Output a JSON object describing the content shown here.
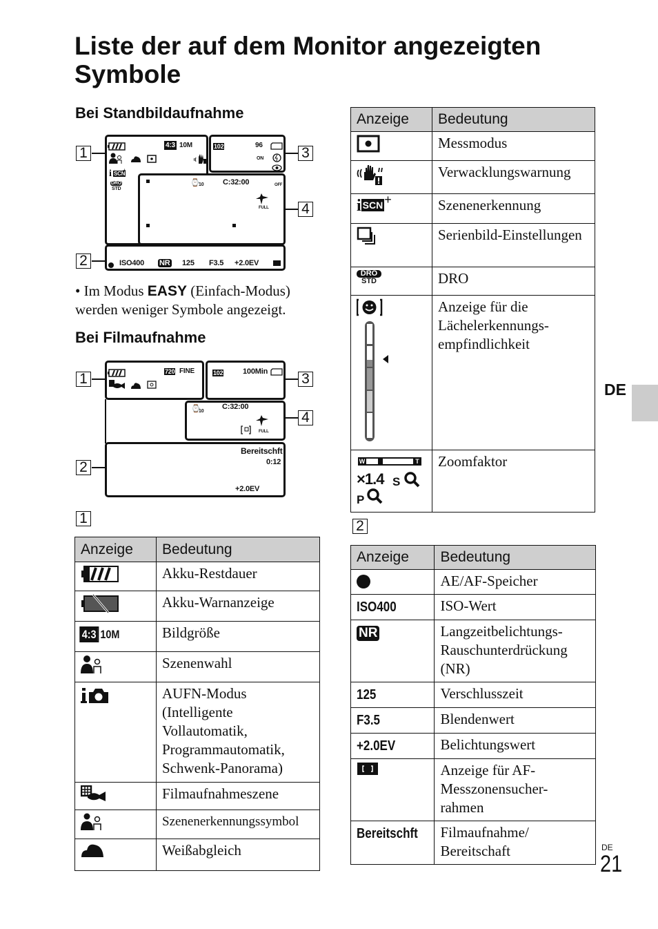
{
  "title": "Liste der auf dem Monitor angezeigten Symbole",
  "sections": {
    "still": "Bei Standbildaufnahme",
    "movie": "Bei Filmaufnahme"
  },
  "note": {
    "bullet": "•",
    "prefix": "Im Modus",
    "mode": "EASY",
    "suffix": "(Einfach-Modus) werden weniger Symbole angezeigt."
  },
  "callouts": [
    "1",
    "2",
    "3",
    "4"
  ],
  "still_display": {
    "image_size": "4:3",
    "megapixels": "10M",
    "folder": "102",
    "shots_left": "96",
    "face_detect": "ON",
    "timer": "10",
    "clock": "C:32:00",
    "smile": "OFF",
    "full": "FULL",
    "iso": "ISO400",
    "nr": "NR",
    "shutter": "125",
    "aperture": "F3.5",
    "ev": "+2.0EV",
    "dro": "DRO",
    "dro_std": "STD",
    "scn": "SCN"
  },
  "movie_display": {
    "quality": "720",
    "fine": "FINE",
    "folder": "102",
    "remaining": "100Min",
    "timer": "10",
    "clock": "C:32:00",
    "full": "FULL",
    "standby": "Bereitschft",
    "elapsed": "0:12",
    "ev": "+2.0EV"
  },
  "table1": {
    "label": "1",
    "headers": [
      "Anzeige",
      "Bedeutung"
    ],
    "rows": [
      {
        "icon": "battery-full-icon",
        "meaning": "Akku-Restdauer"
      },
      {
        "icon": "battery-warning-icon",
        "meaning": "Akku-Warnanzeige"
      },
      {
        "icon": "image-size-icon",
        "code_box": "4:3",
        "code": "10M",
        "meaning": "Bildgröße"
      },
      {
        "icon": "scene-select-icon",
        "meaning": "Szenenwahl"
      },
      {
        "icon": "intelligent-auto-icon",
        "meaning": "AUFN-Modus (Intelligente Vollautomatik, Programmautomatik, Schwenk-Panorama)"
      },
      {
        "icon": "movie-scene-icon",
        "meaning": "Filmaufnahmeszene"
      },
      {
        "icon": "scene-recognition-icon",
        "meaning": "Szenenerkennungssymbol"
      },
      {
        "icon": "white-balance-icon",
        "meaning": "Weißabgleich"
      }
    ]
  },
  "table1b": {
    "headers": [
      "Anzeige",
      "Bedeutung"
    ],
    "rows": [
      {
        "icon": "metering-mode-icon",
        "meaning": "Messmodus"
      },
      {
        "icon": "shake-warning-icon",
        "meaning": "Verwacklungswarnung"
      },
      {
        "icon": "iscn-plus-icon",
        "code": "SCN",
        "meaning": "Szenenerkennung"
      },
      {
        "icon": "burst-icon",
        "meaning": "Serienbild-Einstellungen"
      },
      {
        "icon": "dro-icon",
        "code": "DRO",
        "code2": "STD",
        "meaning": "DRO"
      },
      {
        "icon": "smile-sensitivity-icon",
        "meaning": "Anzeige für die Lächelerkennungs-empfindlichkeit"
      },
      {
        "icon": "zoom-factor-icon",
        "zoom_w": "W",
        "zoom_t": "T",
        "zoom_value": "×1.4",
        "zoom_s": "S",
        "zoom_p": "P",
        "meaning": "Zoomfaktor"
      }
    ]
  },
  "table2": {
    "label": "2",
    "headers": [
      "Anzeige",
      "Bedeutung"
    ],
    "rows": [
      {
        "icon": "ae-af-lock-icon",
        "meaning": "AE/AF-Speicher"
      },
      {
        "code": "ISO400",
        "meaning": "ISO-Wert"
      },
      {
        "icon": "nr-icon",
        "code": "NR",
        "meaning": "Langzeitbelichtungs-Rauschunterdrückung (NR)"
      },
      {
        "code": "125",
        "meaning": "Verschlusszeit"
      },
      {
        "code": "F3.5",
        "meaning": "Blendenwert"
      },
      {
        "code": "+2.0EV",
        "meaning": "Belichtungswert"
      },
      {
        "icon": "af-frame-icon",
        "meaning": "Anzeige für AF-Messzonensucher-rahmen"
      },
      {
        "code": "Bereitschft",
        "meaning": "Filmaufnahme/ Bereitschaft"
      }
    ]
  },
  "side_tab": "DE",
  "footer": {
    "lang": "DE",
    "page": "21"
  }
}
